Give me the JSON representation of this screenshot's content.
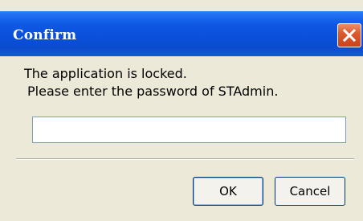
{
  "window": {
    "title": "Confirm"
  },
  "message": {
    "line1": "The application is locked.",
    "line2": "Please enter the password of STAdmin."
  },
  "password": {
    "value": ""
  },
  "buttons": {
    "ok_label": "OK",
    "cancel_label": "Cancel"
  },
  "colors": {
    "titlebar": "#0a50da",
    "close_button": "#dd5a2e",
    "dialog_background": "#ece9d8"
  },
  "icons": {
    "close": "close-icon"
  }
}
